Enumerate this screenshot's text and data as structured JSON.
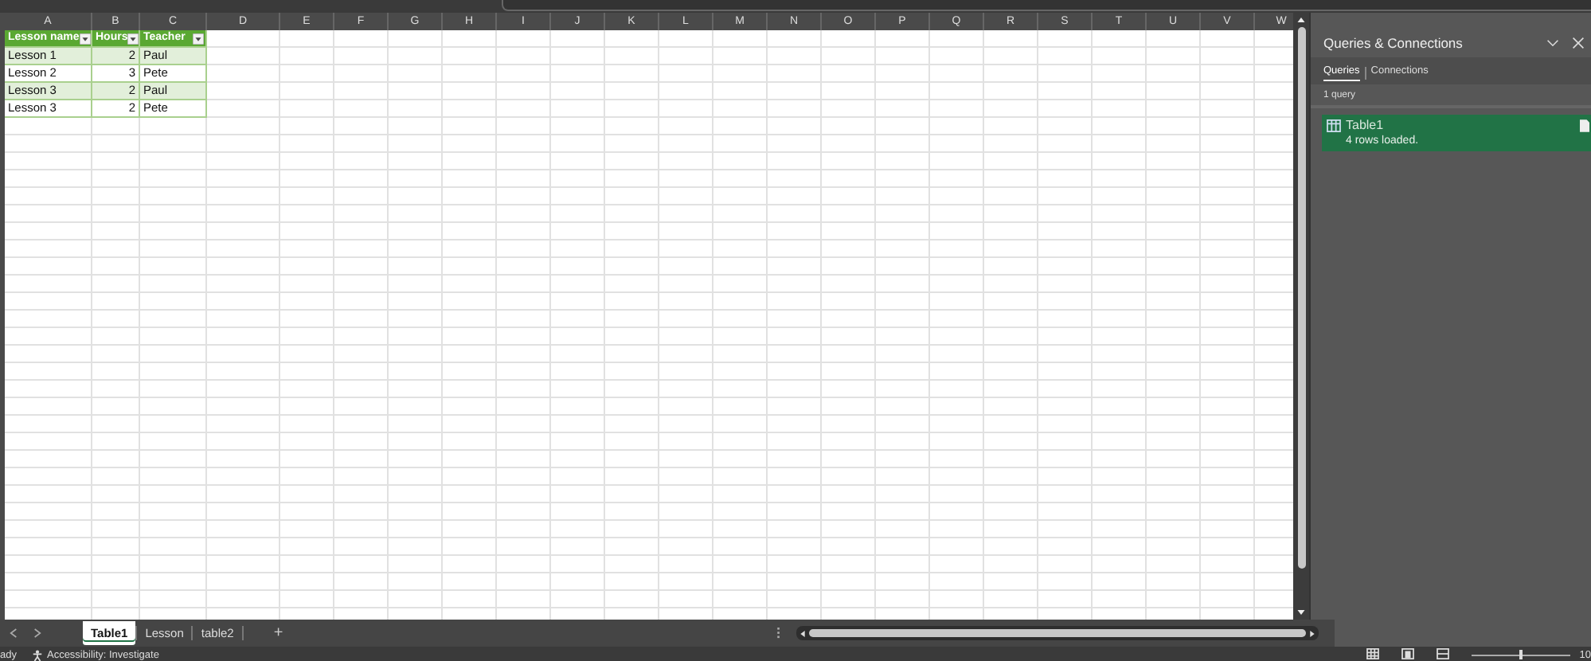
{
  "columns": [
    "A",
    "B",
    "C",
    "D",
    "E",
    "F",
    "G",
    "H",
    "I",
    "J",
    "K",
    "L",
    "M",
    "N",
    "O",
    "P",
    "Q",
    "R",
    "S",
    "T",
    "U",
    "V",
    "W"
  ],
  "table": {
    "headers": [
      "Lesson name",
      "Hours",
      "Teacher"
    ],
    "rows": [
      [
        "Lesson 1",
        "2",
        "Paul"
      ],
      [
        "Lesson 2",
        "3",
        "Pete"
      ],
      [
        "Lesson 3",
        "2",
        "Paul"
      ],
      [
        "Lesson 3",
        "2",
        "Pete"
      ]
    ]
  },
  "sheet_tabs": [
    {
      "label": "Table1",
      "selected": true
    },
    {
      "label": "Lesson",
      "selected": false
    },
    {
      "label": "table2",
      "selected": false
    }
  ],
  "add_sheet": "+",
  "panel": {
    "title": "Queries & Connections",
    "tabs": [
      {
        "label": "Queries",
        "selected": true
      },
      {
        "label": "Connections",
        "selected": false
      }
    ],
    "count": "1 query",
    "queries": [
      {
        "name": "Table1",
        "status": "4 rows loaded.",
        "selected": true
      }
    ]
  },
  "status_bar": {
    "mode": "ady",
    "accessibility": "Accessibility: Investigate",
    "zoom": "10",
    "zoom_slider": {
      "level": 0.5
    }
  }
}
